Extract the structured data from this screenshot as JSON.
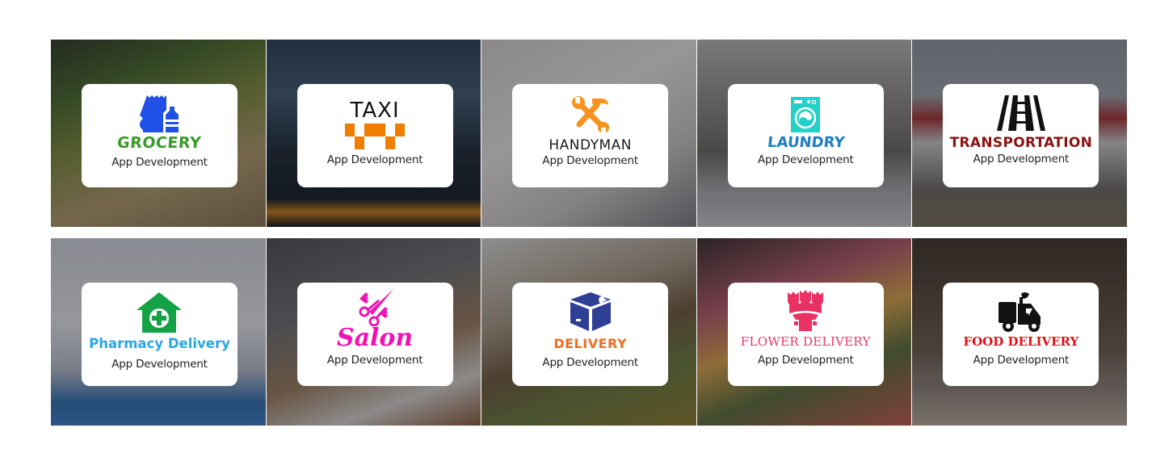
{
  "tiles": [
    {
      "id": "grocery",
      "brand": "GROCERY",
      "brand_color": "#3a9a2a",
      "icon": "grocery-bag-icon",
      "icon_color": "#2150e8",
      "subtitle": "App Development"
    },
    {
      "id": "taxi",
      "brand": "TAXI",
      "brand_color": "#111111",
      "icon": "taxi-checker-icon",
      "icon_color": "#f07d00",
      "subtitle": "App Development"
    },
    {
      "id": "handyman",
      "brand": "HANDYMAN",
      "brand_color": "#1a1a1a",
      "icon": "wrench-hammer-icon",
      "icon_color": "#f7931e",
      "subtitle": "App Development"
    },
    {
      "id": "laundry",
      "brand": "LAUNDRY",
      "brand_color": "#1e7fc1",
      "icon": "washing-machine-icon",
      "icon_color": "#23d1c8",
      "subtitle": "App Development"
    },
    {
      "id": "transportation",
      "brand": "TRANSPORTATION",
      "brand_color": "#8b1212",
      "icon": "road-icon",
      "icon_color": "#111111",
      "subtitle": "App Development"
    },
    {
      "id": "pharmacy",
      "brand": "Pharmacy Delivery",
      "brand_color": "#29a8e0",
      "icon": "pharmacy-house-cross-icon",
      "icon_color": "#13a346",
      "subtitle": "App Development"
    },
    {
      "id": "salon",
      "brand": "Salon",
      "brand_color": "#f012b5",
      "icon": "scissors-comb-icon",
      "icon_color": "#f012b5",
      "subtitle": "App Development"
    },
    {
      "id": "delivery",
      "brand": "DELIVERY",
      "brand_color": "#f26b21",
      "icon": "package-box-icon",
      "icon_color": "#2f3f96",
      "subtitle": "App Development"
    },
    {
      "id": "flower",
      "brand": "FLOWER DELIVERY",
      "brand_color": "#e8386a",
      "icon": "flower-bouquet-icon",
      "icon_color": "#ea3164",
      "subtitle": "App Development"
    },
    {
      "id": "food",
      "brand": "FOOD DELIVERY",
      "brand_color": "#e3101b",
      "icon": "delivery-scooter-icon",
      "icon_color": "#111111",
      "subtitle": "App Development"
    }
  ]
}
